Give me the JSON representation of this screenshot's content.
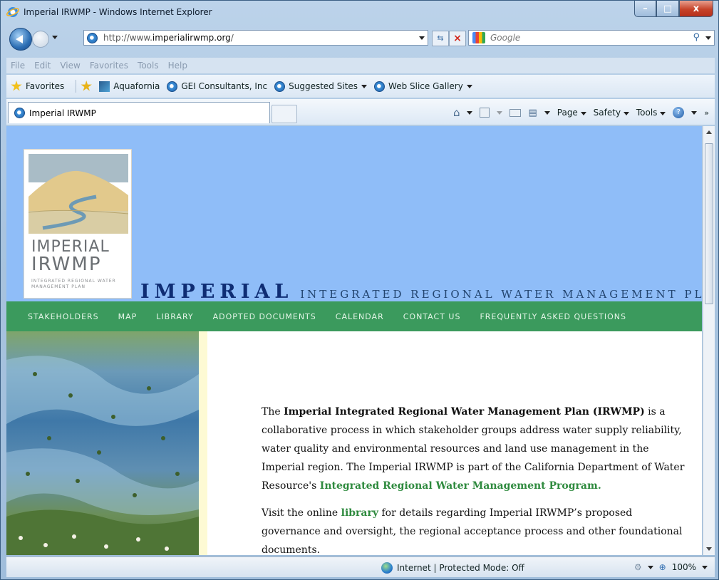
{
  "window": {
    "title": "Imperial IRWMP - Windows Internet Explorer"
  },
  "address": {
    "url_prefix": "http://www.",
    "url_host": "imperialirwmp.org",
    "url_suffix": "/"
  },
  "search": {
    "placeholder": "Google"
  },
  "menu": [
    "File",
    "Edit",
    "View",
    "Favorites",
    "Tools",
    "Help"
  ],
  "favorites": {
    "label": "Favorites",
    "items": [
      "Aquafornia",
      "GEI Consultants, Inc",
      "Suggested Sites",
      "Web Slice Gallery"
    ]
  },
  "tab": {
    "title": "Imperial IRWMP"
  },
  "commands": {
    "page": "Page",
    "safety": "Safety",
    "tools": "Tools"
  },
  "site": {
    "logo": {
      "line1": "IMPERIAL",
      "line2": "IRWMP",
      "line3": "INTEGRATED REGIONAL WATER MANAGEMENT PLAN"
    },
    "title_main": "IMPERIAL",
    "title_sub": "INTEGRATED REGIONAL WATER MANAGEMENT PLAN",
    "nav": [
      "STAKEHOLDERS",
      "MAP",
      "LIBRARY",
      "ADOPTED DOCUMENTS",
      "CALENDAR",
      "CONTACT US",
      "FREQUENTLY ASKED QUESTIONS"
    ],
    "para1": {
      "before": "The ",
      "bold": "Imperial Integrated Regional Water Management Plan (IRWMP)",
      "after": " is a collaborative process in which stakeholder groups address water supply reliability, water quality and environmental resources and land use management in the Imperial region. The Imperial IRWMP is part of the California Department of Water Resource's ",
      "link": "Integrated Regional Water Management Program."
    },
    "para2": {
      "before": "Visit the online ",
      "link": "library",
      "after": " for details regarding Imperial IRWMP’s proposed governance and oversight, the regional acceptance process and other foundational documents."
    }
  },
  "status": {
    "zone": "Internet | Protected Mode: Off",
    "zoom": "100%"
  },
  "colors": {
    "banner": "#8fbdf8",
    "nav": "#3b9a5d",
    "title": "#0f2d74",
    "link": "#2e8a3e"
  }
}
